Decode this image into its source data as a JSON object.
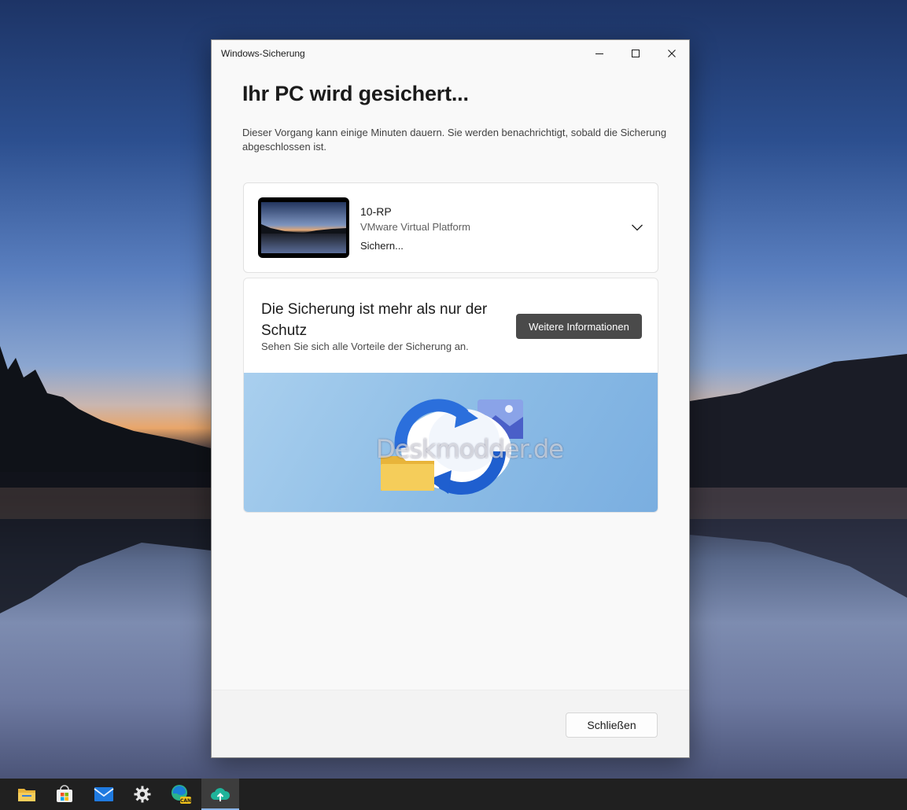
{
  "window": {
    "title": "Windows-Sicherung",
    "heading": "Ihr PC wird gesichert...",
    "description": "Dieser Vorgang kann einige Minuten dauern. Sie werden benachrichtigt, sobald die Sicherung abgeschlossen ist."
  },
  "device": {
    "name": "10-RP",
    "platform": "VMware Virtual Platform",
    "status": "Sichern..."
  },
  "promo": {
    "title": "Die Sicherung ist mehr als nur der Schutz",
    "subtitle": "Sehen Sie sich alle Vorteile der Sicherung an.",
    "button_label": "Weitere Informationen",
    "watermark": "Deskmodder.de"
  },
  "footer": {
    "close_label": "Schließen"
  },
  "taskbar": {
    "items": [
      {
        "icon": "file-explorer-icon"
      },
      {
        "icon": "store-icon"
      },
      {
        "icon": "mail-icon"
      },
      {
        "icon": "settings-gear-icon"
      },
      {
        "icon": "edge-canary-icon",
        "badge": "CAN"
      },
      {
        "icon": "windows-backup-icon",
        "active": true
      }
    ]
  },
  "colors": {
    "accent_button": "#4a4a4a",
    "window_bg": "#f9f9f9",
    "taskbar_bg": "#202020"
  }
}
